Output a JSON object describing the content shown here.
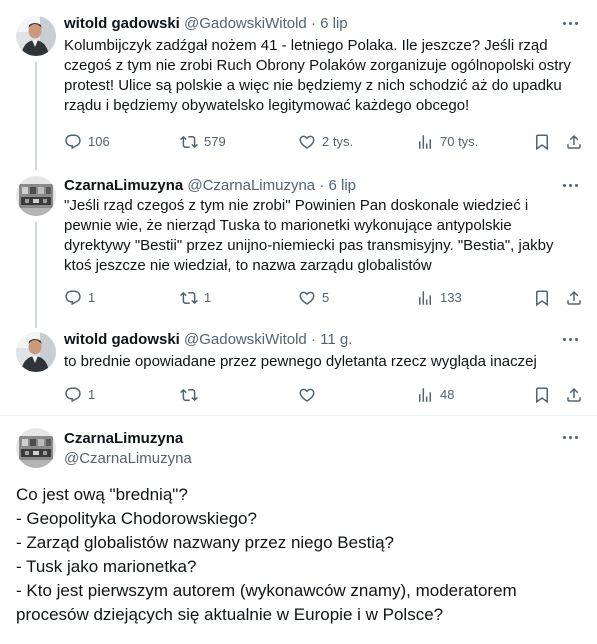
{
  "tweets": [
    {
      "name": "witold gadowski",
      "handle": "@GadowskiWitold",
      "separator": "·",
      "time": "6 lip",
      "lines": [
        "Kolumbijczyk zadźgał nożem 41 - letniego Polaka. Ile jeszcze? Jeśli rząd",
        "czegoś z tym nie zrobi Ruch Obrony Polaków zorganizuje ogólnopolski ostry",
        "protest! Ulice są polskie a więc nie będziemy z nich schodzić aż do upadku",
        "rządu i będziemy obywatelsko legitymować każdego obcego!"
      ],
      "replies": "106",
      "reposts": "579",
      "likes": "2 tys.",
      "views": "70 tys."
    },
    {
      "name": "CzarnaLimuzyna",
      "handle": "@CzarnaLimuzyna",
      "separator": "·",
      "time": "6 lip",
      "lines": [
        "\"Jeśli rząd czegoś z tym nie zrobi\" Powinien Pan doskonale wiedzieć i",
        "pewnie wie, że nierząd Tuska to marionetki wykonujące antypolskie",
        "dyrektywy \"Bestii\" przez unijno-niemiecki pas transmisyjny. \"Bestia\", jakby",
        "ktoś jeszcze nie wiedział, to nazwa zarządu globalistów"
      ],
      "replies": "1",
      "reposts": "1",
      "likes": "5",
      "views": "133"
    },
    {
      "name": "witold gadowski",
      "handle": "@GadowskiWitold",
      "separator": "·",
      "time": "11 g.",
      "lines": [
        "to brednie opowiadane przez pewnego dyletanta rzecz wygląda inaczej"
      ],
      "replies": "1",
      "reposts": "",
      "likes": "",
      "views": "48"
    }
  ],
  "main_tweet": {
    "name": "CzarnaLimuzyna",
    "handle": "@CzarnaLimuzyna",
    "lines": [
      "Co jest ową \"brednią\"?",
      "- Geopolityka Chodorowskiego?",
      "- Zarząd globalistów nazwany przez niego Bestią?",
      "- Tusk jako marionetka?",
      "- Kto jest pierwszym autorem (wykonawców znamy), moderatorem",
      "procesów dziejących się aktualnie w Europie i w Polsce?"
    ]
  },
  "icons": [
    "reply-icon",
    "repost-icon",
    "like-icon",
    "views-icon",
    "bookmark-icon",
    "share-icon",
    "more-icon"
  ],
  "colors": {
    "text": "#0f1419",
    "secondary": "#536471",
    "thread_line": "#cfd9de",
    "divider": "#eff3f4"
  }
}
